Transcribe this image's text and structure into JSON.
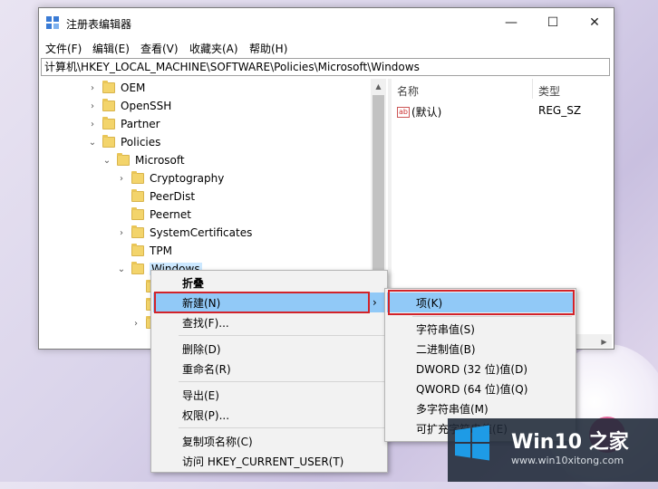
{
  "window": {
    "title": "注册表编辑器",
    "controls": {
      "minimize": "—",
      "maximize": "☐",
      "close": "✕"
    }
  },
  "menubar": [
    "文件(F)",
    "编辑(E)",
    "查看(V)",
    "收藏夹(A)",
    "帮助(H)"
  ],
  "address": "计算机\\HKEY_LOCAL_MACHINE\\SOFTWARE\\Policies\\Microsoft\\Windows",
  "tree": {
    "items": [
      {
        "label": "OEM",
        "expander": "›"
      },
      {
        "label": "OpenSSH",
        "expander": "›"
      },
      {
        "label": "Partner",
        "expander": "›"
      },
      {
        "label": "Policies",
        "expander": "⌄"
      },
      {
        "label": "Microsoft",
        "expander": "⌄"
      },
      {
        "label": "Cryptography",
        "expander": "›"
      },
      {
        "label": "PeerDist",
        "expander": ""
      },
      {
        "label": "Peernet",
        "expander": ""
      },
      {
        "label": "SystemCertificates",
        "expander": "›"
      },
      {
        "label": "TPM",
        "expander": ""
      },
      {
        "label": "Windows",
        "expander": "⌄"
      }
    ]
  },
  "list": {
    "columns": [
      "名称",
      "类型"
    ],
    "rows": [
      {
        "name": "(默认)",
        "type": "REG_SZ",
        "icon": "ab"
      }
    ]
  },
  "context_menu": {
    "items": [
      {
        "label": "折叠",
        "bold": true
      },
      {
        "label": "新建(N)",
        "submenu_arrow": "›",
        "highlighted": true
      },
      {
        "label": "查找(F)..."
      },
      {
        "label": "删除(D)"
      },
      {
        "label": "重命名(R)"
      },
      {
        "label": "导出(E)"
      },
      {
        "label": "权限(P)..."
      },
      {
        "label": "复制项名称(C)"
      },
      {
        "label": "访问 HKEY_CURRENT_USER(T)"
      }
    ]
  },
  "submenu": {
    "items": [
      {
        "label": "项(K)",
        "highlighted": true
      },
      {
        "label": "字符串值(S)"
      },
      {
        "label": "二进制值(B)"
      },
      {
        "label": "DWORD (32 位)值(D)"
      },
      {
        "label": "QWORD (64 位)值(Q)"
      },
      {
        "label": "多字符串值(M)"
      },
      {
        "label": "可扩充字符串值(E)"
      }
    ]
  },
  "watermark": {
    "title": "Win10 之家",
    "url": "www.win10xitong.com"
  },
  "colors": {
    "highlight": "#91c9f7",
    "callout": "#d2232a",
    "folder": "#f3d46b"
  }
}
